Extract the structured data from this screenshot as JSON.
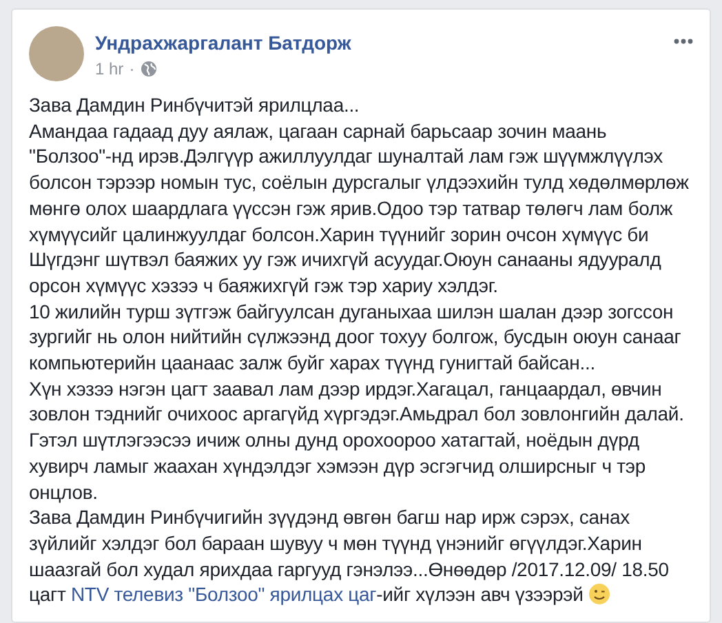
{
  "post": {
    "author": "Ундрахжаргалант Батдорж",
    "time": "1 hr",
    "separator": "·",
    "paragraphs": [
      [
        {
          "kind": "text",
          "text": "Зава Дамдин Ринбүчитэй ярилцлаа..."
        }
      ],
      [
        {
          "kind": "text",
          "text": "Амандаа гадаад дуу аялаж, цагаан сарнай барьсаар зочин маань \"Болзоо\"-нд ирэв.Дэлгүүр ажиллуулдаг шуналтай лам гэж шүүмжлүүлэх болсон тэрээр номын тус, соёлын дурсгалыг үлдээхийн тулд хөдөлмөрлөж мөнгө олох шаардлага үүссэн гэж ярив.Одоо тэр татвар төлөгч лам болж хүмүүсийг цалинжуулдаг болсон.Харин түүнийг зорин очсон хүмүүс би Шүгдэнг шүтвэл баяжих уу гэж ичихгүй асуудаг.Оюун санааны ядууралд орсон хүмүүс хэзээ ч баяжихгүй гэж тэр хариу хэлдэг."
        }
      ],
      [
        {
          "kind": "text",
          "text": "10 жилийн турш зүтгэж байгуулсан дуганыхаа шилэн шалан дээр зогссон зургийг нь олон нийтийн сүлжээнд доог тохуу болгож, бусдын оюун санааг компьютерийн цаанаас залж буйг харах түүнд гунигтай байсан..."
        }
      ],
      [
        {
          "kind": "text",
          "text": "Хүн хэзээ нэгэн цагт заавал лам дээр ирдэг.Хагацал, ганцаардал, өвчин зовлон тэднийг очихоос аргагүйд хүргэдэг.Амьдрал бол зовлонгийн далай. Гэтэл шүтлэгээсээ ичиж олны дунд орохоороо хатагтай, ноёдын дүрд хувирч ламыг жаахан хүндэлдэг хэмээн дүр эсгэгчид олширсныг ч тэр онцлов."
        }
      ],
      [
        {
          "kind": "text",
          "text": "Зава Дамдин Ринбүчигийн зүүдэнд өвгөн багш нар ирж сэрэх, санах зүйлийг хэлдэг бол бараан шувуу ч мөн түүнд үнэнийг өгүүлдэг.Харин шаазгай бол худал ярихдаа гаргууд гэнэлээ...Өнөөдөр /2017.12.09/ 18.50 цагт "
        },
        {
          "kind": "link",
          "text": "NTV телевиз \"Болзоо\" ярилцах цаг"
        },
        {
          "kind": "text",
          "text": "-ийг хүлээн авч үзээрэй "
        },
        {
          "kind": "emoji"
        }
      ]
    ]
  }
}
